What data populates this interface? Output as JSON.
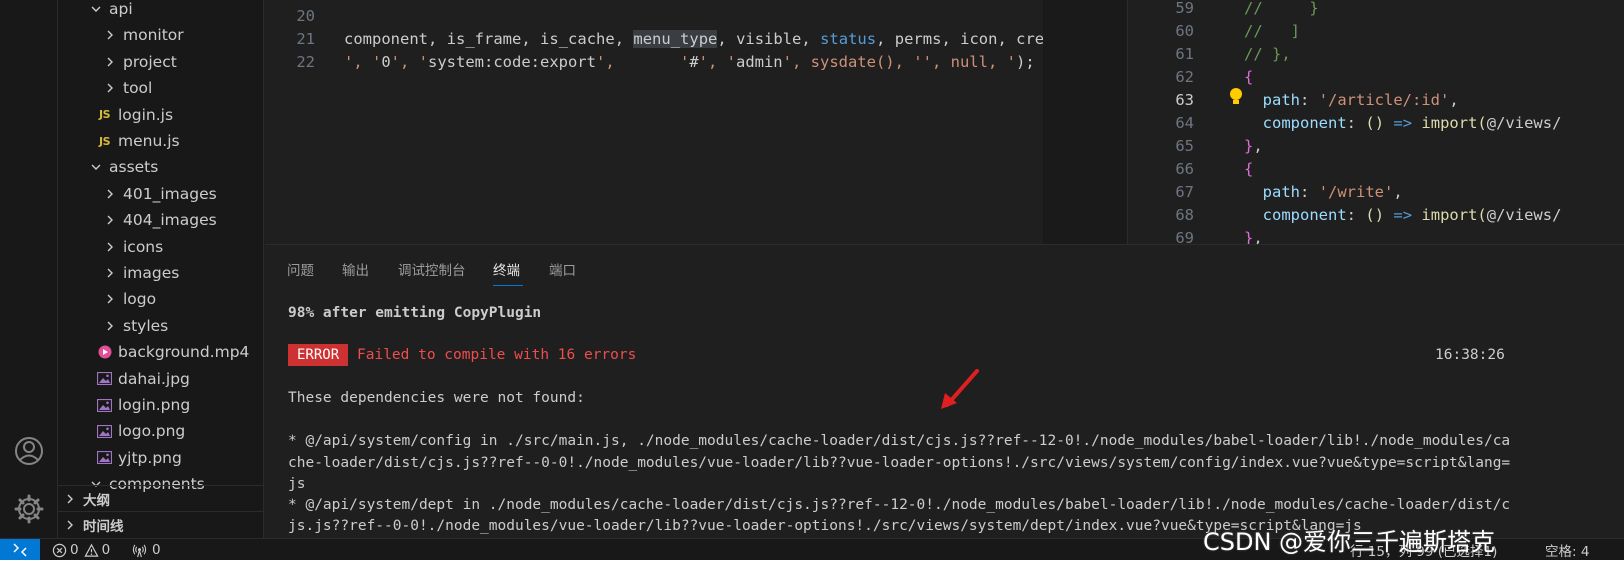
{
  "explorer": {
    "rows": [
      {
        "label": "api",
        "type": "folder-open"
      },
      {
        "label": "monitor",
        "type": "folder"
      },
      {
        "label": "project",
        "type": "folder"
      },
      {
        "label": "tool",
        "type": "folder"
      },
      {
        "label": "login.js",
        "type": "js"
      },
      {
        "label": "menu.js",
        "type": "js"
      },
      {
        "label": "assets",
        "type": "folder-open"
      },
      {
        "label": "401_images",
        "type": "folder"
      },
      {
        "label": "404_images",
        "type": "folder"
      },
      {
        "label": "icons",
        "type": "folder"
      },
      {
        "label": "images",
        "type": "folder"
      },
      {
        "label": "logo",
        "type": "folder"
      },
      {
        "label": "styles",
        "type": "folder"
      },
      {
        "label": "background.mp4",
        "type": "video"
      },
      {
        "label": "dahai.jpg",
        "type": "image"
      },
      {
        "label": "login.png",
        "type": "image"
      },
      {
        "label": "logo.png",
        "type": "image"
      },
      {
        "label": "yjtp.png",
        "type": "image"
      },
      {
        "label": "components",
        "type": "folder-open"
      }
    ],
    "sections": {
      "outline": "大纲",
      "timeline": "时间线"
    }
  },
  "editor_left": {
    "lines": [
      {
        "num": "20",
        "text": ""
      },
      {
        "num": "21",
        "text": "component, is_frame, is_cache, menu_type, visible, status, perms, icon, crea"
      },
      {
        "num": "22",
        "text": "', '0', 'system:code:export',       '#', 'admin', sysdate(), '', null, '');"
      }
    ]
  },
  "editor_right": {
    "lines": [
      {
        "num": "59",
        "text": "//     }"
      },
      {
        "num": "60",
        "text": "//   ]"
      },
      {
        "num": "61",
        "text": "// },"
      },
      {
        "num": "62",
        "text": "{"
      },
      {
        "num": "63",
        "text": "  path: '/article/:id',"
      },
      {
        "num": "64",
        "text": "  component: () => import('@/views/"
      },
      {
        "num": "65",
        "text": "},"
      },
      {
        "num": "66",
        "text": "{"
      },
      {
        "num": "67",
        "text": "  path: '/write',"
      },
      {
        "num": "68",
        "text": "  component: () => import('@/views/"
      },
      {
        "num": "69",
        "text": "},"
      }
    ],
    "active_line": "63"
  },
  "panel": {
    "tabs": [
      "问题",
      "输出",
      "调试控制台",
      "终端",
      "端口"
    ],
    "active_tab": "终端",
    "terminal": {
      "progress": "98% after emitting CopyPlugin",
      "error_badge": "ERROR",
      "error_message": "Failed to compile with 16 errors",
      "timestamp": "16:38:26",
      "deps_heading": "These dependencies were not found:",
      "lines": [
        "* @/api/system/config in ./src/main.js, ./node_modules/cache-loader/dist/cjs.js??ref--12-0!./node_modules/babel-loader/lib!./node_modules/ca",
        "che-loader/dist/cjs.js??ref--0-0!./node_modules/vue-loader/lib??vue-loader-options!./src/views/system/config/index.vue?vue&type=script&lang=",
        "js",
        "* @/api/system/dept in ./node_modules/cache-loader/dist/cjs.js??ref--12-0!./node_modules/babel-loader/lib!./node_modules/cache-loader/dist/c",
        "js.js??ref--0-0!./node_modules/vue-loader/lib??vue-loader-options!./src/views/system/dept/index.vue?vue&type=script&lang=js"
      ]
    }
  },
  "status_bar": {
    "errors": "0",
    "warnings": "0",
    "ports": "0",
    "cursor": "行 15，列 99 (已选择1)",
    "indent": "空格: 4"
  },
  "watermark": "CSDN @爱你三千遍斯塔克",
  "colors": {
    "accent": "#0078d4",
    "error": "#cd3131",
    "arrow": "#e02020"
  }
}
